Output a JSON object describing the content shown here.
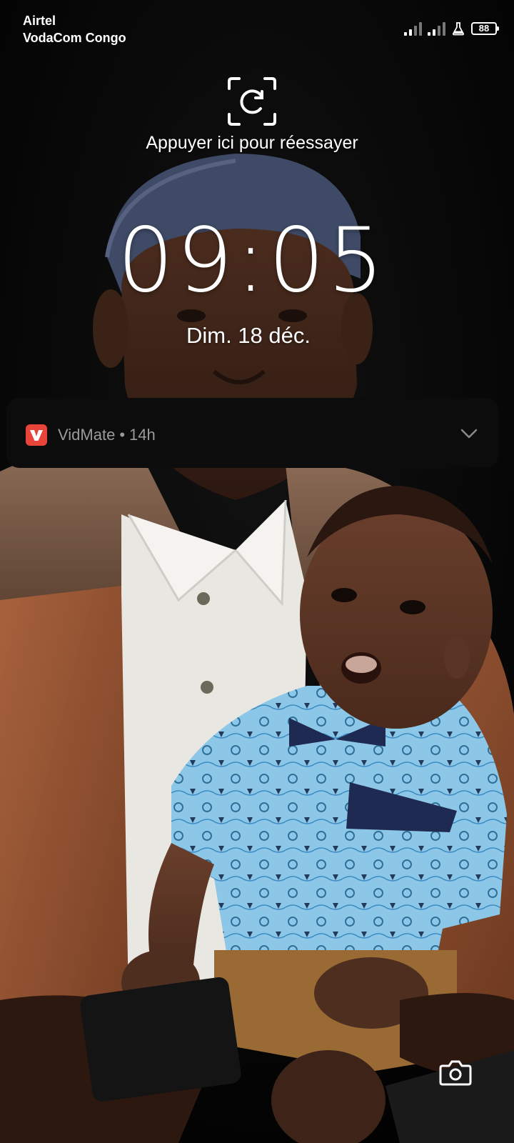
{
  "status_bar": {
    "carrier_1": "Airtel",
    "carrier_2": "VodaCom Congo",
    "battery_level": "88",
    "icons": [
      "signal-icon",
      "signal-icon",
      "lab-flask-icon",
      "battery-icon"
    ]
  },
  "lockscreen": {
    "face_unlock_retry": "Appuyer ici pour réessayer",
    "time": "09:05",
    "date": "Dim. 18 déc."
  },
  "notification": {
    "app_name": "VidMate",
    "separator": "•",
    "age": "14h",
    "app_icon_color": "#e8443a",
    "icon": "chevron-down-icon"
  },
  "shortcuts": {
    "camera_icon": "camera-icon"
  }
}
